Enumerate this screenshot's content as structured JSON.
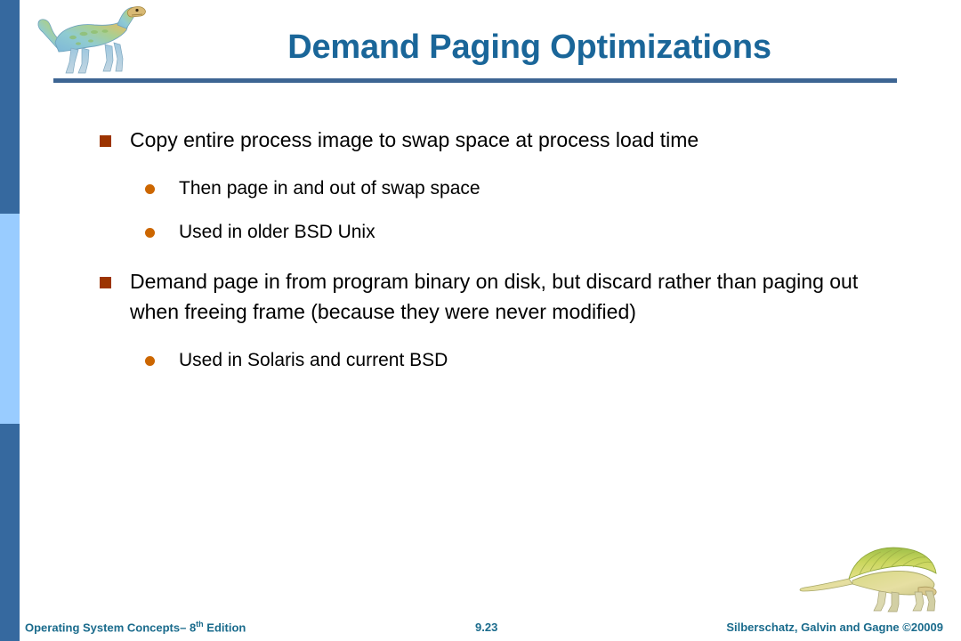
{
  "slide": {
    "title": "Demand Paging Optimizations",
    "accent_color": "#1A6699",
    "rule_color": "#3D6593",
    "sidebar_dark_color": "#36699F",
    "sidebar_light_color": "#99CCFF",
    "level1_bullet_color": "#9C3400",
    "level2_bullet_color": "#CC6600",
    "body_text_color": "#000000"
  },
  "body": {
    "bullets": [
      {
        "level": 1,
        "text": "Copy entire process image to swap space at process load time"
      },
      {
        "level": 2,
        "text": "Then page in and out of swap space"
      },
      {
        "level": 2,
        "text": "Used in older BSD Unix"
      },
      {
        "level": 1,
        "text": "Demand page in from program binary on disk, but discard rather than paging out when freeing frame (because they were never modified)"
      },
      {
        "level": 2,
        "text": "Used in Solaris and current BSD"
      }
    ]
  },
  "footer": {
    "book_prefix": "Operating System Concepts– 8",
    "book_superscript": "th",
    "book_suffix": " Edition",
    "page_number": "9.23",
    "credit": "Silberschatz, Galvin and Gagne ©20009"
  },
  "decor": {
    "header_dinosaur": "dinosaur-icon",
    "footer_dinosaur": "sail-backed-dinosaur-icon"
  }
}
